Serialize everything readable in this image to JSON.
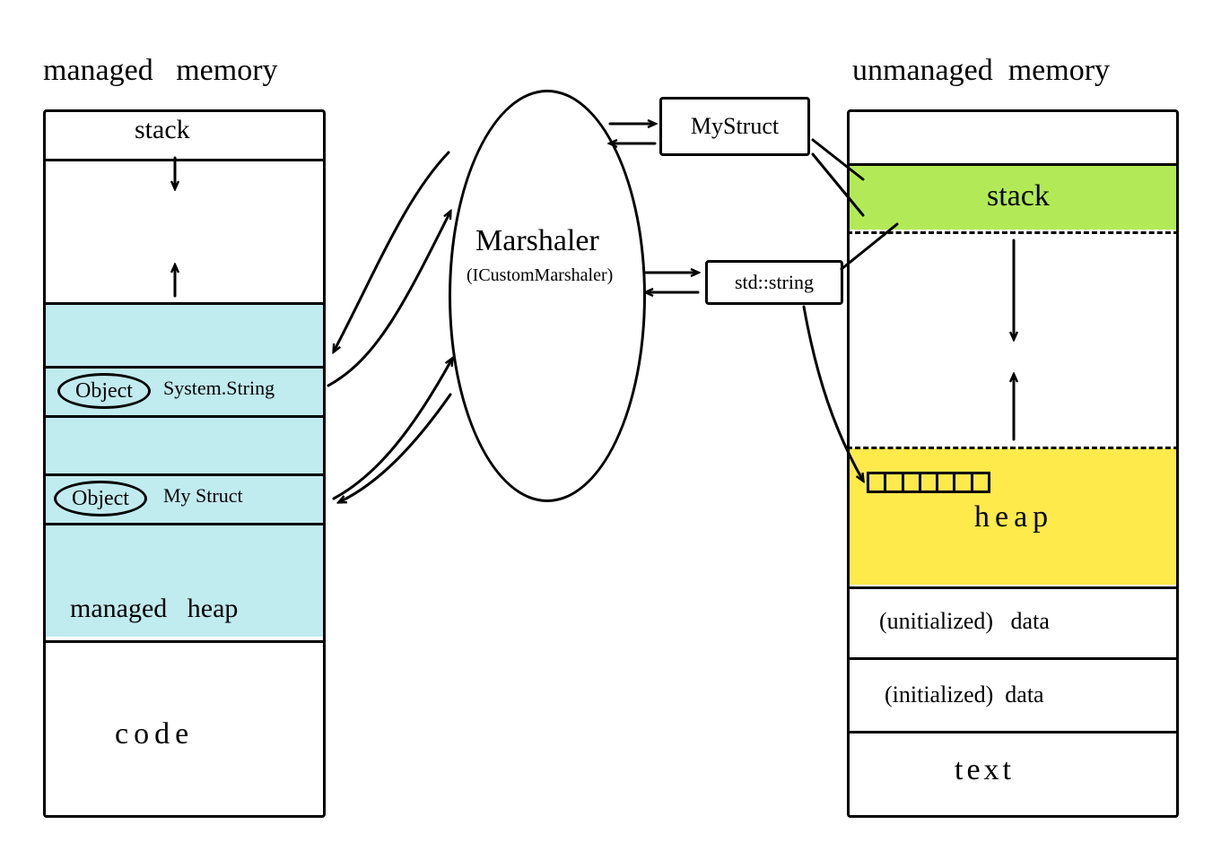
{
  "titles": {
    "managed": "managed   memory",
    "unmanaged": "unmanaged  memory"
  },
  "managed": {
    "stack": "stack",
    "object1_tag": "Object",
    "object1_type": "System.String",
    "object2_tag": "Object",
    "object2_type": "My Struct",
    "heap": "managed   heap",
    "code": "code"
  },
  "marshaler": {
    "title": "Marshaler",
    "subtitle": "(ICustomMarshaler)"
  },
  "native_boxes": {
    "mystruct": "MyStruct",
    "stdstring": "std::string"
  },
  "unmanaged": {
    "stack": "stack",
    "heap": "heap",
    "uninit": "(unitialized)   data",
    "init": "(initialized)  data",
    "text": "text"
  }
}
